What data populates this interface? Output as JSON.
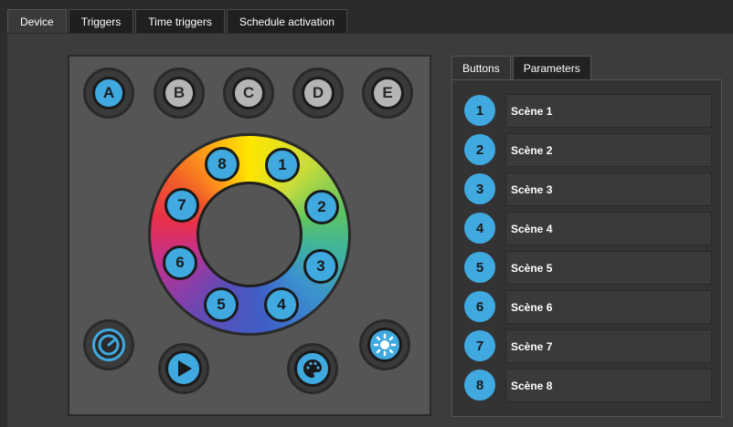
{
  "main_tabs": [
    {
      "label": "Device",
      "active": true
    },
    {
      "label": "Triggers",
      "active": false
    },
    {
      "label": "Time triggers",
      "active": false
    },
    {
      "label": "Schedule activation",
      "active": false
    }
  ],
  "device": {
    "zone_buttons": [
      {
        "label": "A",
        "selected": true
      },
      {
        "label": "B",
        "selected": false
      },
      {
        "label": "C",
        "selected": false
      },
      {
        "label": "D",
        "selected": false
      },
      {
        "label": "E",
        "selected": false
      }
    ],
    "wheel_buttons": [
      "1",
      "2",
      "3",
      "4",
      "5",
      "6",
      "7",
      "8"
    ],
    "icons": {
      "dimmer": "gauge-icon",
      "play": "play-icon",
      "palette": "palette-icon",
      "brightness": "sun-icon"
    },
    "colors": {
      "accent": "#3fa9e0",
      "selected_zone": "#3fa9e0",
      "unselected_zone": "#b5b5b5"
    }
  },
  "side_tabs": [
    {
      "label": "Buttons",
      "active": true
    },
    {
      "label": "Parameters",
      "active": false
    }
  ],
  "scenes": [
    {
      "num": "1",
      "name": "Scène 1"
    },
    {
      "num": "2",
      "name": "Scène 2"
    },
    {
      "num": "3",
      "name": "Scène 3"
    },
    {
      "num": "4",
      "name": "Scène 4"
    },
    {
      "num": "5",
      "name": "Scène 5"
    },
    {
      "num": "6",
      "name": "Scène 6"
    },
    {
      "num": "7",
      "name": "Scène 7"
    },
    {
      "num": "8",
      "name": "Scène 8"
    }
  ]
}
